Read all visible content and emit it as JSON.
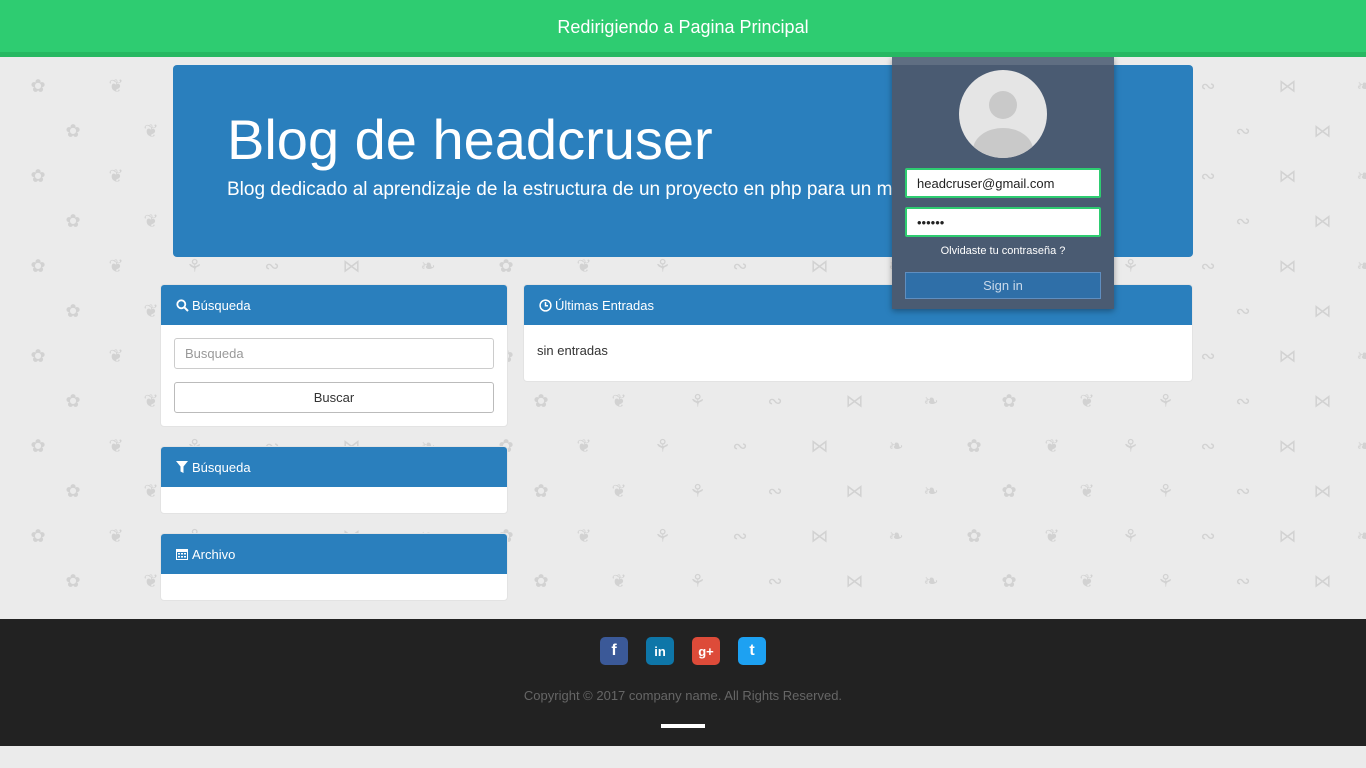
{
  "notification": {
    "message": "Redirigiendo a Pagina Principal",
    "color": "#2ecc71"
  },
  "header": {
    "title": "Blog de headcruser",
    "subtitle": "Blog dedicado al aprendizaje de la estructura de un proyecto en php para un mej",
    "color": "#2a7fbd"
  },
  "login": {
    "email_value": "headcruser@gmail.com",
    "password_value": "••••••",
    "forgot_label": "Olvidaste tu contraseña ?",
    "signin_label": "Sign in"
  },
  "sidebar": {
    "search_panel": {
      "title": "Búsqueda",
      "icon": "search-icon",
      "placeholder": "Busqueda",
      "button_label": "Buscar"
    },
    "filter_panel": {
      "title": "Búsqueda",
      "icon": "filter-icon"
    },
    "archive_panel": {
      "title": "Archivo",
      "icon": "calendar-icon"
    }
  },
  "main": {
    "latest_panel": {
      "title": "Últimas Entradas",
      "icon": "clock-icon",
      "empty_text": "sin entradas"
    }
  },
  "footer": {
    "socials": [
      {
        "name": "facebook",
        "glyph": "f",
        "color": "#3b5998"
      },
      {
        "name": "linkedin",
        "glyph": "in",
        "color": "#0e76a8"
      },
      {
        "name": "google-plus",
        "glyph": "g+",
        "color": "#dd4b39"
      },
      {
        "name": "twitter",
        "glyph": "t",
        "color": "#1da1f2"
      }
    ],
    "copyright": "Copyright © 2017 company name. All Rights Reserved."
  }
}
